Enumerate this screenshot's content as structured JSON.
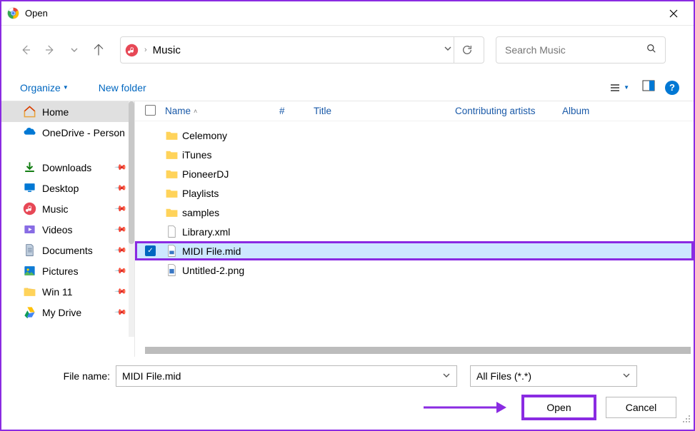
{
  "window": {
    "title": "Open"
  },
  "nav": {
    "crumb": "Music"
  },
  "search": {
    "placeholder": "Search Music"
  },
  "toolbar": {
    "organize": "Organize",
    "newfolder": "New folder"
  },
  "sidebar": {
    "home": "Home",
    "onedrive": "OneDrive - Person",
    "downloads": "Downloads",
    "desktop": "Desktop",
    "music": "Music",
    "videos": "Videos",
    "documents": "Documents",
    "pictures": "Pictures",
    "win11": "Win 11",
    "mydrive": "My Drive"
  },
  "columns": {
    "name": "Name",
    "num": "#",
    "title": "Title",
    "artists": "Contributing artists",
    "album": "Album"
  },
  "files": {
    "f0": "Celemony",
    "f1": "iTunes",
    "f2": "PioneerDJ",
    "f3": "Playlists",
    "f4": "samples",
    "f5": "Library.xml",
    "f6": "MIDI File.mid",
    "f7": "Untitled-2.png"
  },
  "footer": {
    "filename_label": "File name:",
    "filename_value": "MIDI File.mid",
    "filter": "All Files (*.*)",
    "open": "Open",
    "cancel": "Cancel"
  }
}
